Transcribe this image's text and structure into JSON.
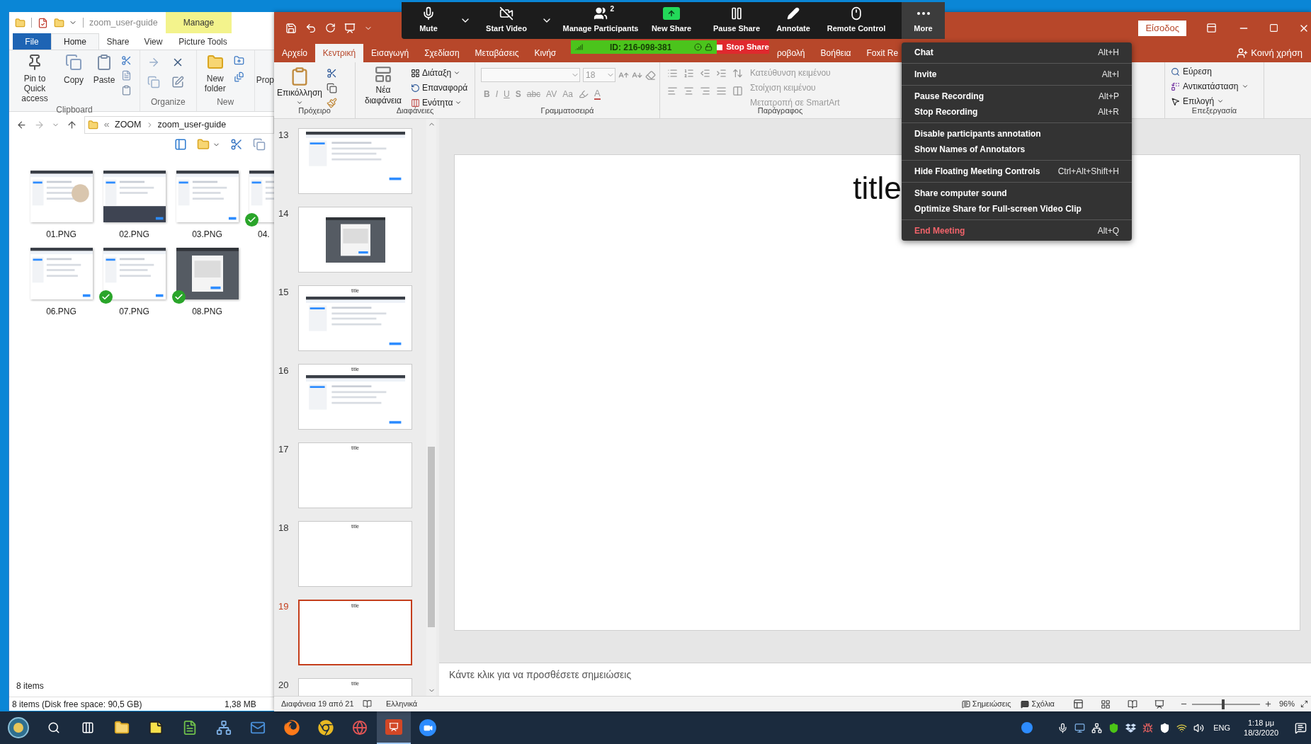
{
  "explorer": {
    "title": "zoom_user-guide",
    "context_tab": "Manage",
    "tabs": [
      {
        "label": "File",
        "kind": "file",
        "selected": false
      },
      {
        "label": "Home",
        "kind": "tab",
        "selected": true
      },
      {
        "label": "Share",
        "kind": "tab",
        "selected": false
      },
      {
        "label": "View",
        "kind": "tab",
        "selected": false
      },
      {
        "label": "Picture Tools",
        "kind": "tab",
        "selected": false
      }
    ],
    "ribbon": {
      "clipboard": {
        "label": "Clipboard",
        "pin": "Pin to Quick access",
        "copy": "Copy",
        "paste": "Paste"
      },
      "organize": {
        "label": "Organize"
      },
      "new": {
        "label": "New",
        "new_folder": "New folder"
      },
      "properties": {
        "label": "Prop"
      }
    },
    "path": [
      "ZOOM",
      "zoom_user-guide"
    ],
    "file_rows": [
      [
        {
          "name": "01.PNG",
          "synced": false,
          "cut": false
        },
        {
          "name": "02.PNG",
          "synced": false,
          "cut": false
        },
        {
          "name": "03.PNG",
          "synced": false,
          "cut": false
        },
        {
          "name": "04.",
          "synced": true,
          "cut": true
        }
      ],
      [
        {
          "name": "06.PNG",
          "synced": false,
          "cut": false
        },
        {
          "name": "07.PNG",
          "synced": true,
          "cut": false
        },
        {
          "name": "08.PNG",
          "synced": true,
          "cut": false
        }
      ]
    ],
    "item_count": "8 items",
    "status": "8 items (Disk free space: 90,5 GB)",
    "size": "1,38 MB"
  },
  "powerpoint": {
    "signin": "Είσοδος",
    "share": "Κοινή χρήση",
    "tabs_left": [
      {
        "label": "Αρχείο",
        "selected": false
      },
      {
        "label": "Κεντρική",
        "selected": true
      },
      {
        "label": "Εισαγωγή",
        "selected": false
      },
      {
        "label": "Σχεδίαση",
        "selected": false
      },
      {
        "label": "Μεταβάσεις",
        "selected": false
      },
      {
        "label": "Κινήσ",
        "selected": false
      }
    ],
    "tabs_right": [
      {
        "label": "ροβολή",
        "selected": false
      },
      {
        "label": "Βοήθεια",
        "selected": false
      },
      {
        "label": "Foxit Re",
        "selected": false
      }
    ],
    "ribbon": {
      "clipboard": {
        "label": "Πρόχειρο",
        "paste": "Επικόλληση"
      },
      "slides": {
        "label": "Διαφάνειες",
        "new_slide": "Νέα διαφάνεια",
        "layout": "Διάταξη",
        "reset": "Επαναφορά",
        "section": "Ενότητα"
      },
      "font": {
        "label": "Γραμματοσειρά",
        "disabled": true,
        "size": "18",
        "format_buttons": [
          {
            "text": "B",
            "kind": "bold"
          },
          {
            "text": "I",
            "kind": "italic"
          },
          {
            "text": "U",
            "kind": "underline"
          },
          {
            "text": "S",
            "kind": "shadow"
          },
          {
            "text": "abc",
            "kind": "strike"
          },
          {
            "text": "AV",
            "kind": "spacing"
          },
          {
            "text": "Aa",
            "kind": "case"
          }
        ],
        "color_button": "A"
      },
      "paragraph": {
        "label": "Παράγραφος",
        "disabled": true,
        "text_direction": "Κατεύθυνση κειμένου",
        "align_text": "Στοίχιση κειμένου",
        "smartart": "Μετατροπή σε SmartArt"
      },
      "editing": {
        "label": "Επεξεργασία",
        "find": "Εύρεση",
        "replace": "Αντικατάσταση",
        "select": "Επιλογή"
      }
    },
    "slides": [
      {
        "number": "13",
        "kind": "screenshot",
        "selected": false
      },
      {
        "number": "14",
        "kind": "dark_screenshot",
        "selected": false
      },
      {
        "number": "15",
        "kind": "screenshot",
        "title": "title",
        "selected": false
      },
      {
        "number": "16",
        "kind": "screenshot",
        "title": "title",
        "selected": false
      },
      {
        "number": "17",
        "kind": "title",
        "title": "title",
        "selected": false
      },
      {
        "number": "18",
        "kind": "title",
        "title": "title",
        "selected": false
      },
      {
        "number": "19",
        "kind": "title",
        "title": "title",
        "selected": true
      },
      {
        "number": "20",
        "kind": "title",
        "title": "title",
        "selected": false
      }
    ],
    "slide_title": "title",
    "notes_placeholder": "Κάντε κλικ για να προσθέσετε σημειώσεις",
    "status": {
      "slide_position": "Διαφάνεια 19 από 21",
      "language": "Ελληνικά",
      "notes": "Σημειώσεις",
      "comments": "Σχόλια",
      "zoom": "96%",
      "zoom_slider": {
        "level": 0.46
      }
    }
  },
  "zoom_toolbar": {
    "buttons": [
      {
        "kind": "mic",
        "label": "Mute",
        "active": false
      },
      {
        "kind": "caret",
        "active": false
      },
      {
        "kind": "video_off",
        "label": "Start Video",
        "active": false
      },
      {
        "kind": "caret",
        "active": false
      },
      {
        "kind": "participants",
        "label": "Manage Participants",
        "badge": "2",
        "active": false
      },
      {
        "kind": "new_share",
        "label": "New Share",
        "active": false
      },
      {
        "kind": "pause",
        "label": "Pause Share",
        "active": false
      },
      {
        "kind": "annotate",
        "label": "Annotate",
        "active": false
      },
      {
        "kind": "remote",
        "label": "Remote Control",
        "active": false
      },
      {
        "kind": "more",
        "label": "More",
        "active": true
      }
    ]
  },
  "meeting_bar": {
    "id": "ID: 216-098-381",
    "stop_share": "Stop Share"
  },
  "zoom_menu": {
    "sections": [
      [
        {
          "label": "Chat",
          "shortcut": "Alt+H",
          "kind": "normal"
        }
      ],
      [
        {
          "label": "Invite",
          "shortcut": "Alt+I",
          "kind": "normal"
        }
      ],
      [
        {
          "label": "Pause Recording",
          "shortcut": "Alt+P",
          "kind": "normal"
        },
        {
          "label": "Stop Recording",
          "shortcut": "Alt+R",
          "kind": "normal"
        }
      ],
      [
        {
          "label": "Disable participants annotation",
          "kind": "normal"
        },
        {
          "label": "Show Names of Annotators",
          "kind": "normal"
        }
      ],
      [
        {
          "label": "Hide Floating Meeting Controls",
          "shortcut": "Ctrl+Alt+Shift+H",
          "kind": "normal"
        }
      ],
      [
        {
          "label": "Share computer sound",
          "kind": "normal"
        },
        {
          "label": "Optimize Share for Full-screen Video Clip",
          "kind": "normal"
        }
      ],
      [
        {
          "label": "End Meeting",
          "shortcut": "Alt+Q",
          "kind": "danger"
        }
      ]
    ]
  },
  "taskbar": {
    "apps": [
      {
        "kind": "start",
        "active": false
      },
      {
        "kind": "search",
        "active": false
      },
      {
        "kind": "task_view",
        "active": false
      },
      {
        "kind": "explorer",
        "active": false
      },
      {
        "kind": "sticky_notes",
        "active": false
      },
      {
        "kind": "notepad",
        "active": false
      },
      {
        "kind": "network",
        "active": false
      },
      {
        "kind": "mail",
        "active": false
      },
      {
        "kind": "firefox",
        "active": false
      },
      {
        "kind": "chrome",
        "active": false
      },
      {
        "kind": "app",
        "active": false
      },
      {
        "kind": "powerpoint",
        "active": true
      },
      {
        "kind": "zoom",
        "active": false
      }
    ],
    "language": "ENG",
    "time": "1:18 μμ",
    "date": "18/3/2020"
  }
}
